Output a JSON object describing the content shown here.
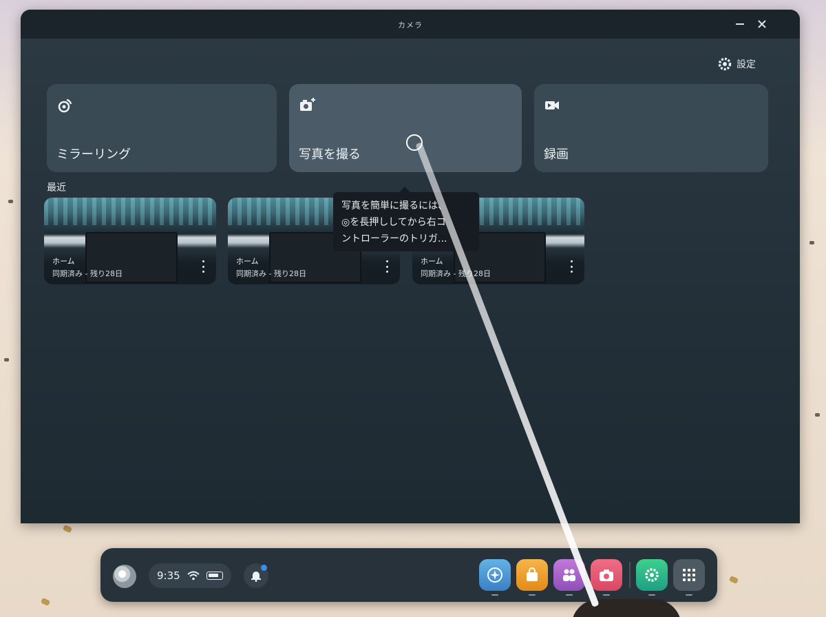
{
  "window": {
    "title": "カメラ",
    "minimize_icon": "minimize-icon",
    "close_icon": "close-icon"
  },
  "settings": {
    "label": "設定",
    "icon": "gear-icon"
  },
  "actions": [
    {
      "id": "mirroring",
      "label": "ミラーリング",
      "icon": "cast-icon"
    },
    {
      "id": "take-photo",
      "label": "写真を撮る",
      "icon": "camera-plus-icon"
    },
    {
      "id": "record",
      "label": "録画",
      "icon": "video-icon"
    }
  ],
  "recent": {
    "label": "最近",
    "items": [
      {
        "title": "ホーム",
        "subtitle": "同期済み - 残り28日"
      },
      {
        "title": "ホーム",
        "subtitle": "同期済み - 残り28日"
      },
      {
        "title": "ホーム",
        "subtitle": "同期済み - 残り28日"
      }
    ]
  },
  "tooltip": {
    "lines": [
      "写真を簡単に撮るには、",
      "◎を長押ししてから右コ",
      "ントローラーのトリガ..."
    ]
  },
  "dock": {
    "time": "9:35",
    "status_icons": [
      "wifi-icon",
      "battery-icon"
    ],
    "notification_icon": "bell-icon",
    "apps": [
      {
        "name": "explore",
        "icon": "compass-icon",
        "color": "#4b97d6"
      },
      {
        "name": "store",
        "icon": "bag-icon",
        "color": "#eea030"
      },
      {
        "name": "people",
        "icon": "people-icon",
        "color": "#a865c8"
      },
      {
        "name": "camera",
        "icon": "camera-icon",
        "color": "#e55a74"
      },
      {
        "name": "settings",
        "icon": "settings-icon",
        "color": "#2fb889"
      },
      {
        "name": "app-library",
        "icon": "grid-icon",
        "color": "#4e5a62"
      }
    ]
  }
}
